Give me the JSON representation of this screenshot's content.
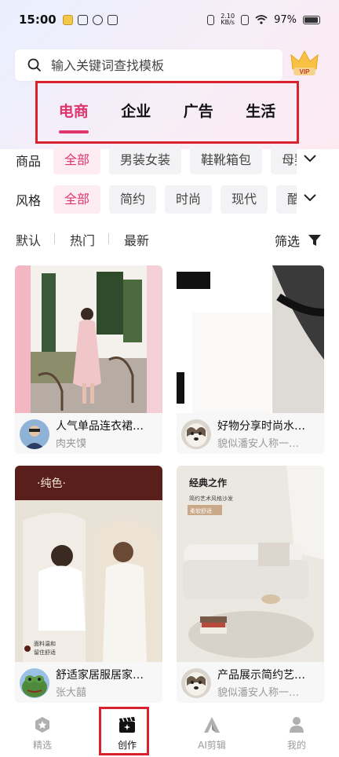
{
  "status": {
    "time": "15:00",
    "net_speed_value": "2.10",
    "net_speed_unit": "KB/s",
    "battery": "97%"
  },
  "search": {
    "placeholder": "输入关键词查找模板",
    "vip_label": "VIP"
  },
  "categories": [
    {
      "label": "电商",
      "active": true
    },
    {
      "label": "企业",
      "active": false
    },
    {
      "label": "广告",
      "active": false
    },
    {
      "label": "生活",
      "active": false
    }
  ],
  "filters": {
    "product": {
      "label": "商品",
      "chips": [
        "全部",
        "男装女装",
        "鞋靴箱包",
        "母婴"
      ]
    },
    "style": {
      "label": "风格",
      "chips": [
        "全部",
        "简约",
        "时尚",
        "现代",
        "酷"
      ]
    }
  },
  "sort": {
    "options": [
      "默认",
      "热门",
      "最新"
    ],
    "filter_label": "筛选"
  },
  "cards": [
    {
      "title": "人气单品连衣裙…",
      "author": "肉夹馍"
    },
    {
      "title": "好物分享时尚水…",
      "author": "貌似潘安人称一…"
    },
    {
      "title": "舒适家居服居家…",
      "author": "张大囍",
      "overlay_title": "·纯色·",
      "overlay_tag1": "面料温和",
      "overlay_tag2": "留住舒适"
    },
    {
      "title": "产品展示简约艺…",
      "author": "貌似潘安人称一…",
      "overlay_title": "经典之作",
      "overlay_sub": "简约艺术风格沙发",
      "overlay_tag": "柔软舒适"
    }
  ],
  "nav": [
    {
      "label": "精选",
      "icon": "star-badge-icon"
    },
    {
      "label": "创作",
      "icon": "clapperboard-icon"
    },
    {
      "label": "AI剪辑",
      "icon": "ai-logo-icon"
    },
    {
      "label": "我的",
      "icon": "person-icon"
    }
  ],
  "colors": {
    "accent": "#e0356c",
    "highlight_border": "#d8232f"
  }
}
